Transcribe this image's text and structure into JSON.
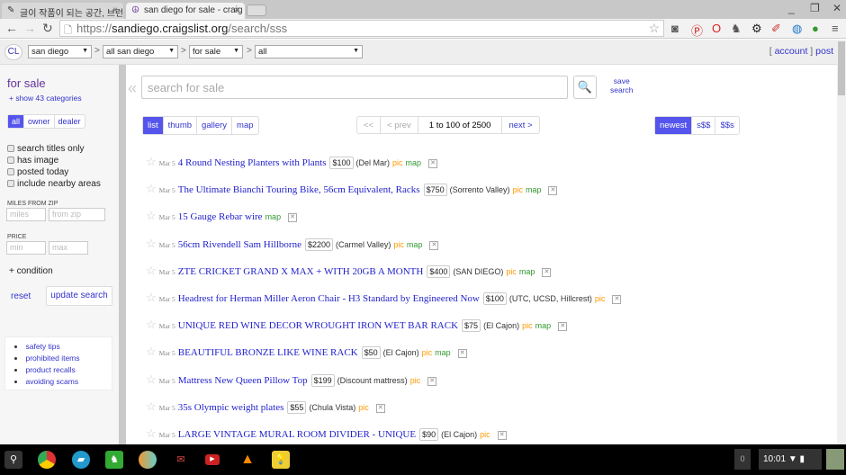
{
  "browser": {
    "tabs": [
      {
        "title": "글이 작품이 되는 공간, 브런",
        "icon": "pen-icon"
      },
      {
        "title": "san diego for sale - craig",
        "icon": "peace-icon"
      }
    ],
    "url_scheme": "https://",
    "url_host": "sandiego.craigslist.org",
    "url_path": "/search/sss"
  },
  "nav": {
    "logo": "CL",
    "selects": [
      "san diego",
      "all san diego",
      "for sale",
      "all"
    ],
    "separator": ">",
    "account": "account",
    "post": "post",
    "bracket_open": "[",
    "bracket_close": "]"
  },
  "sidebar": {
    "title": "for sale",
    "show_categories": "+ show 43 categories",
    "seller_types": [
      "all",
      "owner",
      "dealer"
    ],
    "checkboxes": [
      "search titles only",
      "has image",
      "posted today",
      "include nearby areas"
    ],
    "miles_label": "MILES FROM ZIP",
    "miles_placeholder": "miles",
    "zip_placeholder": "from zip",
    "price_label": "PRICE",
    "min_placeholder": "min",
    "max_placeholder": "max",
    "condition": "+ condition",
    "reset": "reset",
    "update": "update search",
    "links": [
      "safety tips",
      "prohibited items",
      "product recalls",
      "avoiding scams"
    ]
  },
  "search": {
    "placeholder": "search for sale",
    "save_line1": "save",
    "save_line2": "search"
  },
  "views": [
    "list",
    "thumb",
    "gallery",
    "map"
  ],
  "pager": {
    "first": "<<",
    "prev": "< prev",
    "range": "1 to 100 of 2500",
    "next": "next >"
  },
  "sort": [
    "newest",
    "s$$",
    "$$s"
  ],
  "listings": [
    {
      "date": "Mar 5",
      "title": "4 Round Nesting Planters with Plants",
      "price": "$100",
      "hood": "(Del Mar)",
      "pic": "pic",
      "map": "map"
    },
    {
      "date": "Mar 5",
      "title": "The Ultimate Bianchi Touring Bike, 56cm Equivalent, Racks",
      "price": "$750",
      "hood": "(Sorrento Valley)",
      "pic": "pic",
      "map": "map"
    },
    {
      "date": "Mar 5",
      "title": "15 Gauge Rebar wire",
      "price": null,
      "hood": null,
      "pic": null,
      "map": "map"
    },
    {
      "date": "Mar 5",
      "title": "56cm Rivendell Sam Hillborne",
      "price": "$2200",
      "hood": "(Carmel Valley)",
      "pic": "pic",
      "map": "map"
    },
    {
      "date": "Mar 5",
      "title": "ZTE CRICKET GRAND X MAX + WITH 20GB A MONTH",
      "price": "$400",
      "hood": "(SAN DIEGO)",
      "pic": "pic",
      "map": "map"
    },
    {
      "date": "Mar 5",
      "title": "Headrest for Herman Miller Aeron Chair - H3 Standard by Engineered Now",
      "price": "$100",
      "hood": "(UTC, UCSD, Hillcrest)",
      "pic": "pic",
      "map": null
    },
    {
      "date": "Mar 5",
      "title": "UNIQUE RED WINE DECOR WROUGHT IRON WET BAR RACK",
      "price": "$75",
      "hood": "(El Cajon)",
      "pic": "pic",
      "map": "map"
    },
    {
      "date": "Mar 5",
      "title": "BEAUTIFUL BRONZE LIKE WINE RACK",
      "price": "$50",
      "hood": "(El Cajon)",
      "pic": "pic",
      "map": "map"
    },
    {
      "date": "Mar 5",
      "title": "Mattress New Queen Pillow Top",
      "price": "$199",
      "hood": "(Discount mattress)",
      "pic": "pic",
      "map": null
    },
    {
      "date": "Mar 5",
      "title": "35s Olympic weight plates",
      "price": "$55",
      "hood": "(Chula Vista)",
      "pic": "pic",
      "map": null
    },
    {
      "date": "Mar 5",
      "title": "LARGE VINTAGE MURAL ROOM DIVIDER - UNIQUE",
      "price": "$90",
      "hood": "(El Cajon)",
      "pic": "pic",
      "map": null
    }
  ],
  "taskbar": {
    "notifications": "0",
    "time": "10:01"
  },
  "colors": {
    "link": "#2222cc",
    "accent": "#5555ee",
    "pic": "#ff9900",
    "map": "#339933"
  }
}
